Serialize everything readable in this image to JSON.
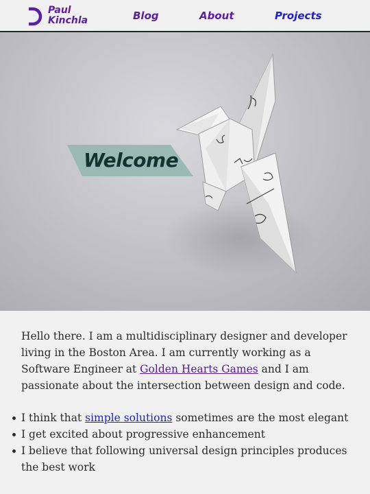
{
  "header": {
    "logo": {
      "line1": "Paul",
      "line2": "Kinchla",
      "icon": "logo-d-icon"
    },
    "nav": [
      {
        "label": "Blog"
      },
      {
        "label": "About"
      },
      {
        "label": "Projects",
        "active": true
      }
    ],
    "colors": {
      "brand": "#5b1fa6",
      "active_link": "#2222cc",
      "border": "#1f2b2a"
    }
  },
  "hero": {
    "welcome": "Welcome",
    "image": "origami-crane-photo",
    "banner_color": "#9ab9b2"
  },
  "intro": {
    "text_before_link": "Hello there. I am a multidisciplinary designer and developer living in the Boston Area. I am currently working as a Software Engineer at ",
    "link_text": "Golden Hearts Games",
    "text_after_link": " and I am passionate about the intersection between design and code."
  },
  "bullets": [
    {
      "before": "I think that ",
      "link": "simple solutions",
      "after": " sometimes are the most elegant"
    },
    {
      "text": "I get excited about progressive enhancement"
    },
    {
      "text": "I believe that following universal design principles produces the best work"
    }
  ]
}
